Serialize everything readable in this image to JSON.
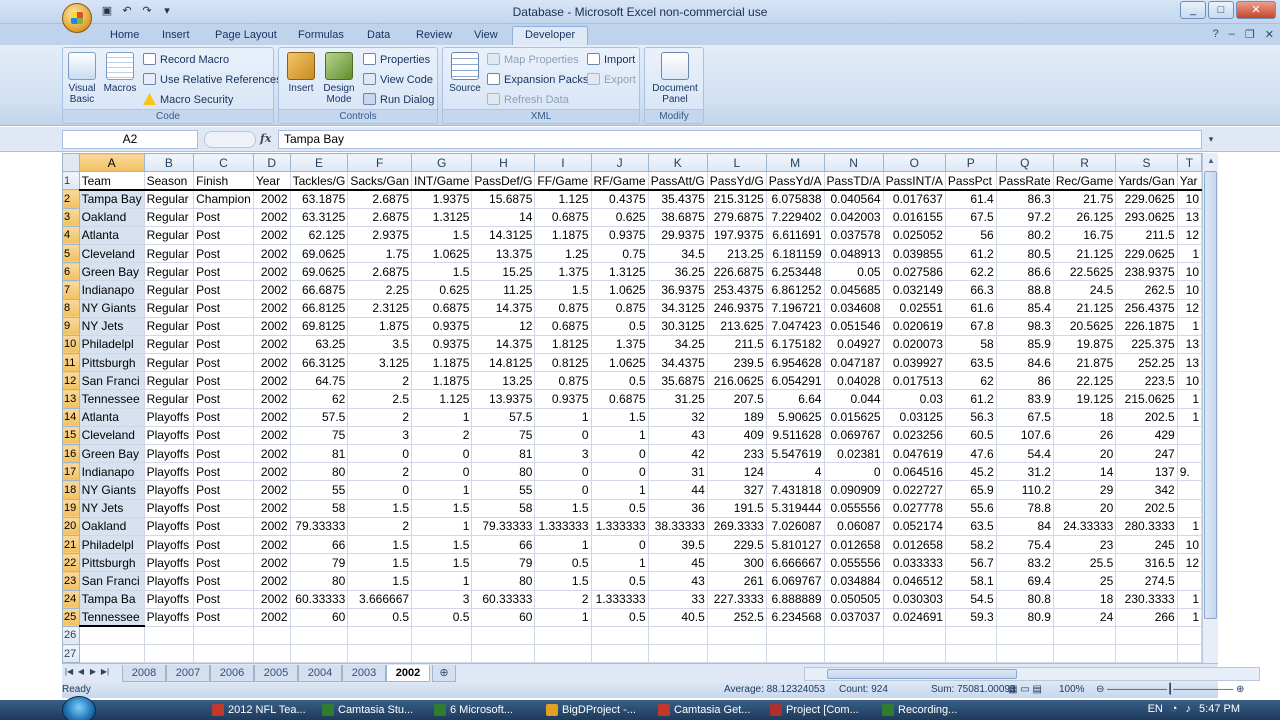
{
  "window": {
    "title": "Database - Microsoft Excel non-commercial use",
    "controls": [
      "_",
      "□",
      "✕"
    ]
  },
  "ribbon": {
    "tabs": [
      "Home",
      "Insert",
      "Page Layout",
      "Formulas",
      "Data",
      "Review",
      "View",
      "Developer"
    ],
    "active_tab": "Developer",
    "groups": {
      "code": {
        "label": "Code",
        "visual_basic": "Visual\nBasic",
        "macros": "Macros",
        "record_macro": "Record Macro",
        "use_relative": "Use Relative References",
        "macro_security": "Macro Security"
      },
      "controls": {
        "label": "Controls",
        "insert": "Insert",
        "design_mode": "Design\nMode",
        "properties": "Properties",
        "view_code": "View Code",
        "run_dialog": "Run Dialog"
      },
      "xml": {
        "label": "XML",
        "source": "Source",
        "map_properties": "Map Properties",
        "expansion_packs": "Expansion Packs",
        "refresh_data": "Refresh Data",
        "import": "Import",
        "export": "Export"
      },
      "modify": {
        "label": "Modify",
        "document_panel": "Document\nPanel"
      }
    }
  },
  "formula_bar": {
    "name_box": "A2",
    "fx": "fx",
    "value": "Tampa Bay"
  },
  "grid": {
    "columns": [
      "A",
      "B",
      "C",
      "D",
      "E",
      "F",
      "G",
      "H",
      "I",
      "J",
      "K",
      "L",
      "M",
      "N",
      "O",
      "P",
      "Q",
      "R",
      "S",
      "T"
    ],
    "selected_column": "A",
    "rows": [
      [
        "Team",
        "Season",
        "Finish",
        "Year",
        "Tackles/G",
        "Sacks/Gan",
        "INT/Game",
        "PassDef/G",
        "FF/Game",
        "RF/Game",
        "PassAtt/G",
        "PassYd/G",
        "PassYd/A",
        "PassTD/A",
        "PassINT/A",
        "PassPct",
        "PassRate",
        "Rec/Game",
        "Yards/Gan",
        "Yar"
      ],
      [
        "Tampa Bay",
        "Regular",
        "Champion",
        "2002",
        "63.1875",
        "2.6875",
        "1.9375",
        "15.6875",
        "1.125",
        "0.4375",
        "35.4375",
        "215.3125",
        "6.075838",
        "0.040564",
        "0.017637",
        "61.4",
        "86.3",
        "21.75",
        "229.0625",
        "10"
      ],
      [
        "Oakland",
        "Regular",
        "Post",
        "2002",
        "63.3125",
        "2.6875",
        "1.3125",
        "14",
        "0.6875",
        "0.625",
        "38.6875",
        "279.6875",
        "7.229402",
        "0.042003",
        "0.016155",
        "67.5",
        "97.2",
        "26.125",
        "293.0625",
        "13"
      ],
      [
        "Atlanta",
        "Regular",
        "Post",
        "2002",
        "62.125",
        "2.9375",
        "1.5",
        "14.3125",
        "1.1875",
        "0.9375",
        "29.9375",
        "197.9375",
        "6.611691",
        "0.037578",
        "0.025052",
        "56",
        "80.2",
        "16.75",
        "211.5",
        "12"
      ],
      [
        "Cleveland",
        "Regular",
        "Post",
        "2002",
        "69.0625",
        "1.75",
        "1.0625",
        "13.375",
        "1.25",
        "0.75",
        "34.5",
        "213.25",
        "6.181159",
        "0.048913",
        "0.039855",
        "61.2",
        "80.5",
        "21.125",
        "229.0625",
        "1"
      ],
      [
        "Green Bay",
        "Regular",
        "Post",
        "2002",
        "69.0625",
        "2.6875",
        "1.5",
        "15.25",
        "1.375",
        "1.3125",
        "36.25",
        "226.6875",
        "6.253448",
        "0.05",
        "0.027586",
        "62.2",
        "86.6",
        "22.5625",
        "238.9375",
        "10"
      ],
      [
        "Indianapo",
        "Regular",
        "Post",
        "2002",
        "66.6875",
        "2.25",
        "0.625",
        "11.25",
        "1.5",
        "1.0625",
        "36.9375",
        "253.4375",
        "6.861252",
        "0.045685",
        "0.032149",
        "66.3",
        "88.8",
        "24.5",
        "262.5",
        "10"
      ],
      [
        "NY Giants",
        "Regular",
        "Post",
        "2002",
        "66.8125",
        "2.3125",
        "0.6875",
        "14.375",
        "0.875",
        "0.875",
        "34.3125",
        "246.9375",
        "7.196721",
        "0.034608",
        "0.02551",
        "61.6",
        "85.4",
        "21.125",
        "256.4375",
        "12"
      ],
      [
        "NY Jets",
        "Regular",
        "Post",
        "2002",
        "69.8125",
        "1.875",
        "0.9375",
        "12",
        "0.6875",
        "0.5",
        "30.3125",
        "213.625",
        "7.047423",
        "0.051546",
        "0.020619",
        "67.8",
        "98.3",
        "20.5625",
        "226.1875",
        "1"
      ],
      [
        "Philadelpl",
        "Regular",
        "Post",
        "2002",
        "63.25",
        "3.5",
        "0.9375",
        "14.375",
        "1.8125",
        "1.375",
        "34.25",
        "211.5",
        "6.175182",
        "0.04927",
        "0.020073",
        "58",
        "85.9",
        "19.875",
        "225.375",
        "13"
      ],
      [
        "Pittsburgh",
        "Regular",
        "Post",
        "2002",
        "66.3125",
        "3.125",
        "1.1875",
        "14.8125",
        "0.8125",
        "1.0625",
        "34.4375",
        "239.5",
        "6.954628",
        "0.047187",
        "0.039927",
        "63.5",
        "84.6",
        "21.875",
        "252.25",
        "13"
      ],
      [
        "San Franci",
        "Regular",
        "Post",
        "2002",
        "64.75",
        "2",
        "1.1875",
        "13.25",
        "0.875",
        "0.5",
        "35.6875",
        "216.0625",
        "6.054291",
        "0.04028",
        "0.017513",
        "62",
        "86",
        "22.125",
        "223.5",
        "10"
      ],
      [
        "Tennessee",
        "Regular",
        "Post",
        "2002",
        "62",
        "2.5",
        "1.125",
        "13.9375",
        "0.9375",
        "0.6875",
        "31.25",
        "207.5",
        "6.64",
        "0.044",
        "0.03",
        "61.2",
        "83.9",
        "19.125",
        "215.0625",
        "1"
      ],
      [
        "Atlanta",
        "Playoffs",
        "Post",
        "2002",
        "57.5",
        "2",
        "1",
        "57.5",
        "1",
        "1.5",
        "32",
        "189",
        "5.90625",
        "0.015625",
        "0.03125",
        "56.3",
        "67.5",
        "18",
        "202.5",
        "1"
      ],
      [
        "Cleveland",
        "Playoffs",
        "Post",
        "2002",
        "75",
        "3",
        "2",
        "75",
        "0",
        "1",
        "43",
        "409",
        "9.511628",
        "0.069767",
        "0.023256",
        "60.5",
        "107.6",
        "26",
        "429",
        ""
      ],
      [
        "Green Bay",
        "Playoffs",
        "Post",
        "2002",
        "81",
        "0",
        "0",
        "81",
        "3",
        "0",
        "42",
        "233",
        "5.547619",
        "0.02381",
        "0.047619",
        "47.6",
        "54.4",
        "20",
        "247",
        ""
      ],
      [
        "Indianapo",
        "Playoffs",
        "Post",
        "2002",
        "80",
        "2",
        "0",
        "80",
        "0",
        "0",
        "31",
        "124",
        "4",
        "0",
        "0.064516",
        "45.2",
        "31.2",
        "14",
        "137",
        "9."
      ],
      [
        "NY Giants",
        "Playoffs",
        "Post",
        "2002",
        "55",
        "0",
        "1",
        "55",
        "0",
        "1",
        "44",
        "327",
        "7.431818",
        "0.090909",
        "0.022727",
        "65.9",
        "110.2",
        "29",
        "342",
        ""
      ],
      [
        "NY Jets",
        "Playoffs",
        "Post",
        "2002",
        "58",
        "1.5",
        "1.5",
        "58",
        "1.5",
        "0.5",
        "36",
        "191.5",
        "5.319444",
        "0.055556",
        "0.027778",
        "55.6",
        "78.8",
        "20",
        "202.5",
        ""
      ],
      [
        "Oakland",
        "Playoffs",
        "Post",
        "2002",
        "79.33333",
        "2",
        "1",
        "79.33333",
        "1.333333",
        "1.333333",
        "38.33333",
        "269.3333",
        "7.026087",
        "0.06087",
        "0.052174",
        "63.5",
        "84",
        "24.33333",
        "280.3333",
        "1"
      ],
      [
        "Philadelpl",
        "Playoffs",
        "Post",
        "2002",
        "66",
        "1.5",
        "1.5",
        "66",
        "1",
        "0",
        "39.5",
        "229.5",
        "5.810127",
        "0.012658",
        "0.012658",
        "58.2",
        "75.4",
        "23",
        "245",
        "10"
      ],
      [
        "Pittsburgh",
        "Playoffs",
        "Post",
        "2002",
        "79",
        "1.5",
        "1.5",
        "79",
        "0.5",
        "1",
        "45",
        "300",
        "6.666667",
        "0.055556",
        "0.033333",
        "56.7",
        "83.2",
        "25.5",
        "316.5",
        "12"
      ],
      [
        "San Franci",
        "Playoffs",
        "Post",
        "2002",
        "80",
        "1.5",
        "1",
        "80",
        "1.5",
        "0.5",
        "43",
        "261",
        "6.069767",
        "0.034884",
        "0.046512",
        "58.1",
        "69.4",
        "25",
        "274.5",
        ""
      ],
      [
        "Tampa Ba",
        "Playoffs",
        "Post",
        "2002",
        "60.33333",
        "3.666667",
        "3",
        "60.33333",
        "2",
        "1.333333",
        "33",
        "227.3333",
        "6.888889",
        "0.050505",
        "0.030303",
        "54.5",
        "80.8",
        "18",
        "230.3333",
        "1"
      ],
      [
        "Tennessee",
        "Playoffs",
        "Post",
        "2002",
        "60",
        "0.5",
        "0.5",
        "60",
        "1",
        "0.5",
        "40.5",
        "252.5",
        "6.234568",
        "0.037037",
        "0.024691",
        "59.3",
        "80.9",
        "24",
        "266",
        "1"
      ],
      [
        "",
        "",
        "",
        "",
        "",
        "",
        "",
        "",
        "",
        "",
        "",
        "",
        "",
        "",
        "",
        "",
        "",
        "",
        "",
        ""
      ],
      [
        "",
        "",
        "",
        "",
        "",
        "",
        "",
        "",
        "",
        "",
        "",
        "",
        "",
        "",
        "",
        "",
        "",
        "",
        "",
        ""
      ]
    ]
  },
  "sheets": {
    "tabs": [
      "2008",
      "2007",
      "2006",
      "2005",
      "2004",
      "2003",
      "2002"
    ],
    "active": "2002"
  },
  "status": {
    "ready": "Ready",
    "average": "Average: 88.12324053",
    "count": "Count: 924",
    "sum": "Sum: 75081.00093",
    "zoom": "100%"
  },
  "taskbar": {
    "items": [
      "2012 NFL Tea...",
      "Camtasia Stu...",
      "6 Microsoft...",
      "BigDProject -...",
      "Camtasia Get...",
      "Project [Com...",
      "Recording..."
    ],
    "language": "EN",
    "clock": "5:47 PM"
  },
  "colors": {
    "ribbon_bg": "#d1e0f2",
    "selected_header": "#f1c15f",
    "selection_fill": "#d8e1f0",
    "grid_line": "#d0d7e5"
  }
}
